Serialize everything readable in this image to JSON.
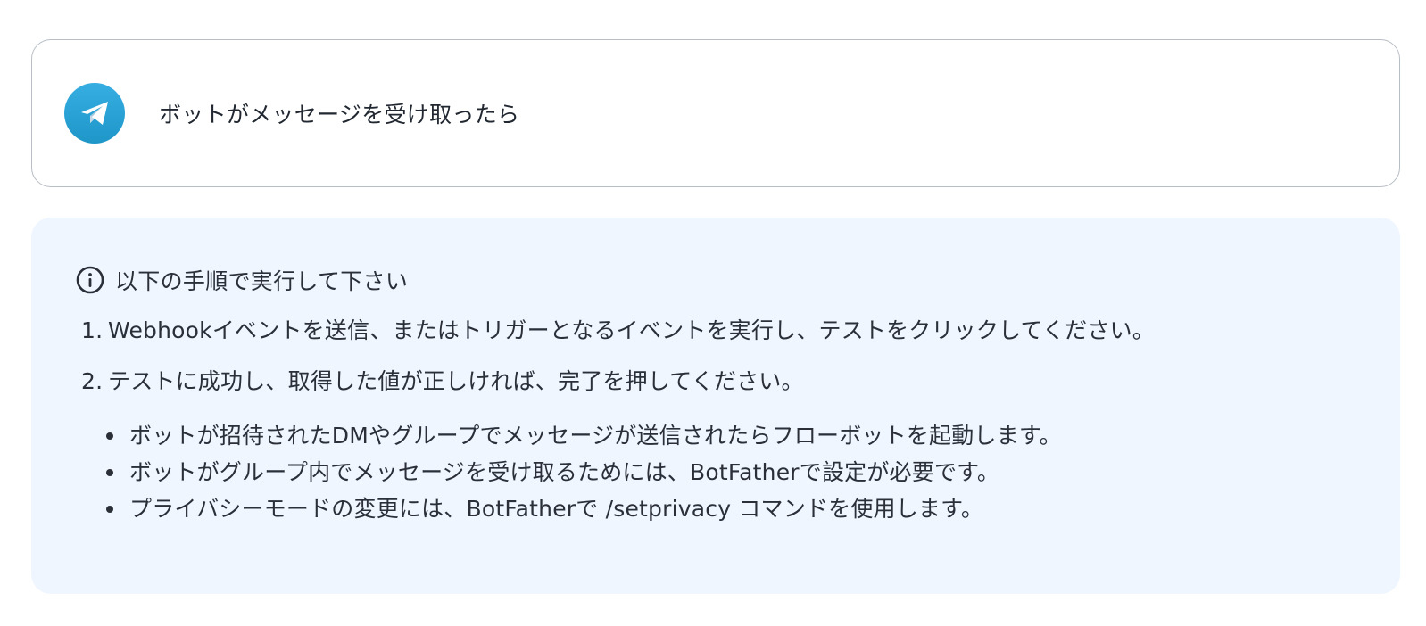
{
  "trigger": {
    "app_icon": "telegram-paper-plane-icon",
    "title": "ボットがメッセージを受け取ったら",
    "brand_color": "#2AABEE"
  },
  "info": {
    "icon": "info-circle-icon",
    "title": "以下の手順で実行して下さい",
    "steps": [
      {
        "number": "1.",
        "text": "Webhookイベントを送信、またはトリガーとなるイベントを実行し、テストをクリックしてください。"
      },
      {
        "number": "2.",
        "text": "テストに成功し、取得した値が正しければ、完了を押してください。"
      }
    ],
    "notes": [
      "ボットが招待されたDMやグループでメッセージが送信されたらフローボットを起動します。",
      "ボットがグループ内でメッセージを受け取るためには、BotFatherで設定が必要です。",
      "プライバシーモードの変更には、BotFatherで /setprivacy コマンドを使用します。"
    ],
    "background_color": "#EFF6FF"
  }
}
